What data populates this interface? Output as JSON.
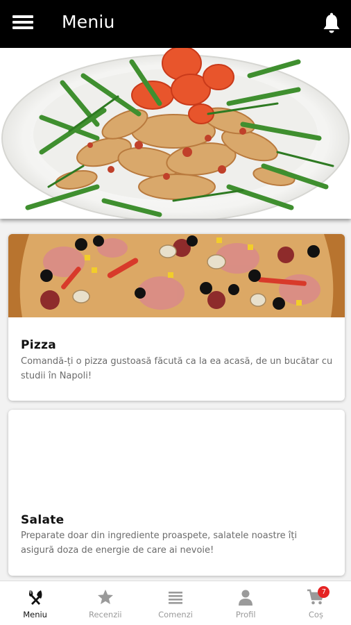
{
  "appbar": {
    "title": "Meniu",
    "menu_icon": "hamburger-icon",
    "notification_icon": "bell-icon",
    "background": "#000000"
  },
  "hero": {
    "image": "pasta-with-arugula-and-tomatoes"
  },
  "categories": [
    {
      "title": "Pizza",
      "description": "Comandă-ți o pizza gustoasă făcută ca la ea acasă, de un bucătar cu studii în Napoli!",
      "image": "pizza-photo"
    },
    {
      "title": "Salate",
      "description": "Preparate doar din ingrediente proaspete, salatele noastre îți asigură doza de energie de care ai nevoie!",
      "image": ""
    }
  ],
  "bottom_nav": {
    "items": [
      {
        "label": "Meniu",
        "icon": "fork-knife-icon",
        "active": true
      },
      {
        "label": "Recenzii",
        "icon": "star-icon",
        "active": false
      },
      {
        "label": "Comenzi",
        "icon": "list-icon",
        "active": false
      },
      {
        "label": "Profil",
        "icon": "person-icon",
        "active": false
      },
      {
        "label": "Coș",
        "icon": "cart-icon",
        "active": false,
        "badge": "7"
      }
    ],
    "active_color": "#111111",
    "inactive_color": "#9a9a9a",
    "badge_color": "#e52424"
  }
}
